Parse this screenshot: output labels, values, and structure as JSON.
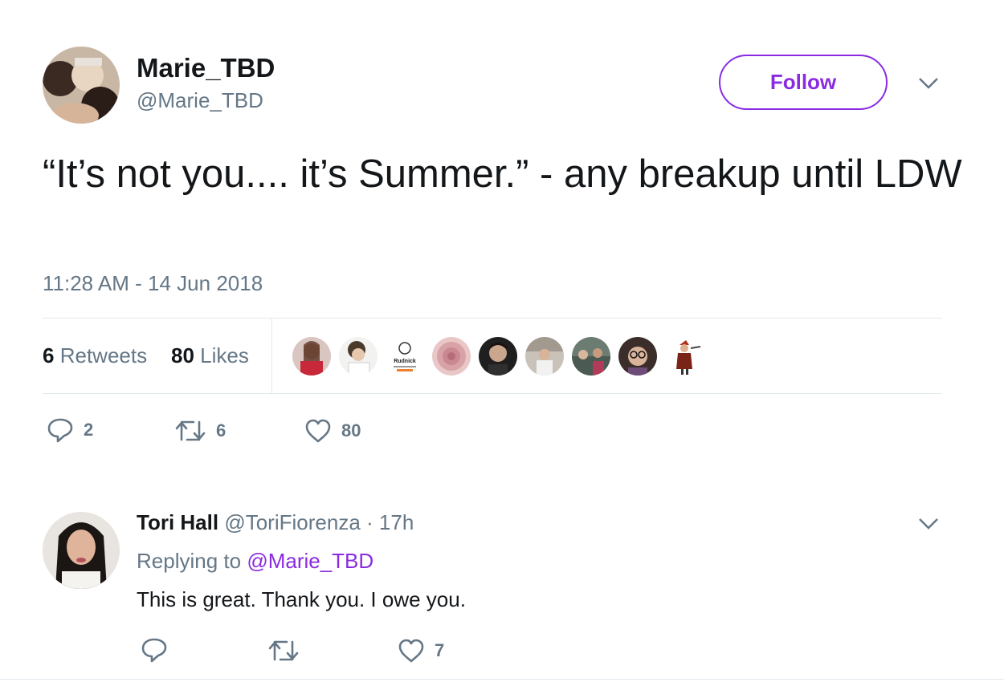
{
  "tweet": {
    "display_name": "Marie_TBD",
    "handle": "@Marie_TBD",
    "follow_label": "Follow",
    "text": "“It’s not you.... it’s Summer.” - any breakup until LDW",
    "timestamp": "11:28 AM - 14 Jun 2018",
    "retweets_count": "6",
    "retweets_label": "Retweets",
    "likes_count": "80",
    "likes_label": "Likes",
    "actions": {
      "reply": "2",
      "retweet": "6",
      "like": "80"
    }
  },
  "likers": [
    {
      "name": "liker-avatar-1"
    },
    {
      "name": "liker-avatar-2"
    },
    {
      "name": "liker-avatar-3"
    },
    {
      "name": "liker-avatar-4"
    },
    {
      "name": "liker-avatar-5"
    },
    {
      "name": "liker-avatar-6"
    },
    {
      "name": "liker-avatar-7"
    },
    {
      "name": "liker-avatar-8"
    },
    {
      "name": "liker-avatar-9"
    }
  ],
  "reply": {
    "display_name": "Tori Hall",
    "handle": "@ToriFiorenza",
    "separator": "·",
    "time": "17h",
    "replying_prefix": "Replying to",
    "replying_handle": "@Marie_TBD",
    "text": "This is great. Thank you. I owe you.",
    "actions": {
      "like": "7"
    }
  },
  "logo_text": "Rudnick",
  "colors": {
    "accent": "#8a2be2",
    "muted": "#657786",
    "divider": "#e1e8ed"
  },
  "icons": [
    "reply-icon",
    "retweet-icon",
    "like-icon",
    "chevron-down-icon"
  ]
}
